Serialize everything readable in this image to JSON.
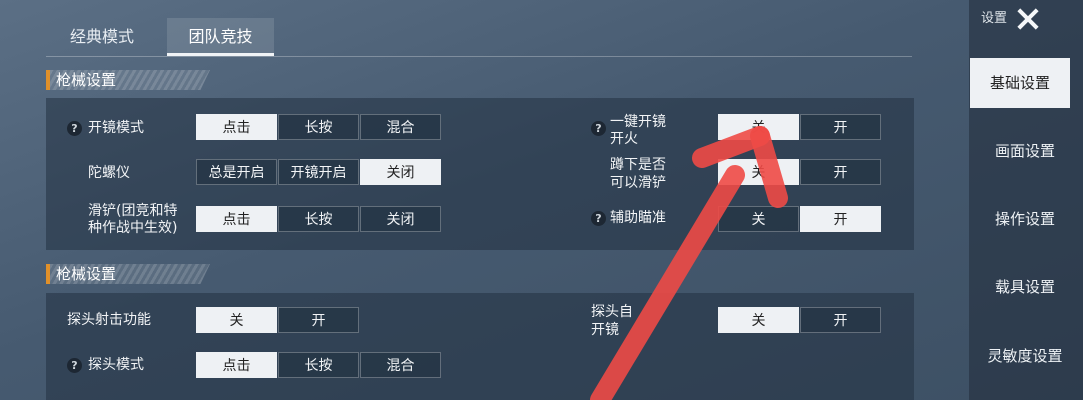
{
  "tabs": {
    "classic": "经典模式",
    "team": "团队竞技"
  },
  "sections": {
    "s1": "枪械设置",
    "s2": "枪械设置"
  },
  "settings": {
    "scope_mode": {
      "label": "开镜模式",
      "options": [
        "点击",
        "长按",
        "混合"
      ],
      "selected": 0
    },
    "gyro": {
      "label": "陀螺仪",
      "options": [
        "总是开启",
        "开镜开启",
        "关闭"
      ],
      "selected": 2
    },
    "slide": {
      "label_line1": "滑铲(团竞和特",
      "label_line2": "种作战中生效)",
      "options": [
        "点击",
        "长按",
        "关闭"
      ],
      "selected": 0
    },
    "one_key_fire": {
      "label_line1": "一键开镜",
      "label_line2": "开火",
      "options": [
        "关",
        "开"
      ],
      "selected": 0
    },
    "crouch_slide": {
      "label_line1": "蹲下是否",
      "label_line2": "可以滑铲",
      "options": [
        "关",
        "开"
      ],
      "selected": 0
    },
    "aim_assist": {
      "label": "辅助瞄准",
      "options": [
        "关",
        "开"
      ],
      "selected": 1
    },
    "peek_fire": {
      "label": "探头射击功能",
      "options": [
        "关",
        "开"
      ],
      "selected": 0
    },
    "peek_auto_scope": {
      "label_line1": "探头自",
      "label_line2": "开镜",
      "options": [
        "关",
        "开"
      ],
      "selected": 0
    },
    "peek_mode": {
      "label": "探头模式",
      "options": [
        "点击",
        "长按",
        "混合"
      ],
      "selected": 0
    }
  },
  "help_glyph": "?",
  "sidebar": {
    "title": "设置",
    "items": [
      "基础设置",
      "画面设置",
      "操作设置",
      "载具设置",
      "灵敏度设置"
    ],
    "active": 0
  },
  "colors": {
    "annotation_arrow": "#ee4a46",
    "section_accent": "#e0902a"
  }
}
